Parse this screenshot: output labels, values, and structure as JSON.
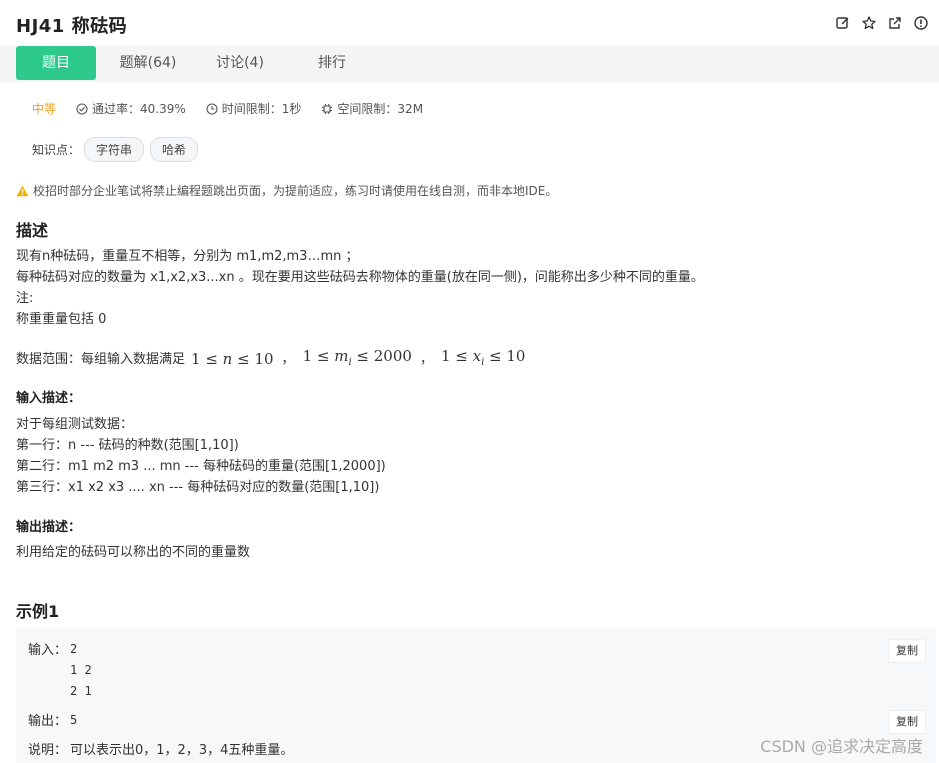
{
  "header": {
    "title": "HJ41  称砝码"
  },
  "tabs": [
    {
      "label": "题目"
    },
    {
      "label": "题解(64)"
    },
    {
      "label": "讨论(4)"
    },
    {
      "label": "排行"
    }
  ],
  "meta": {
    "difficulty": "中等",
    "pass_rate": "通过率：40.39%",
    "time_limit": "时间限制：1秒",
    "memory_limit": "空间限制：32M"
  },
  "knowledge": {
    "label": "知识点：",
    "tags": [
      "字符串",
      "哈希"
    ]
  },
  "notice": "校招时部分企业笔试将禁止编程题跳出页面，为提前适应，练习时请使用在线自测，而非本地IDE。",
  "description": {
    "heading": "描述",
    "lines": [
      "现有n种砝码，重量互不相等，分别为 m1,m2,m3…mn ；",
      "每种砝码对应的数量为 x1,x2,x3...xn 。现在要用这些砝码去称物体的重量(放在同一侧)，问能称出多少种不同的重量。",
      "注:",
      "称重重量包括 0"
    ],
    "range_label": "数据范围：每组输入数据满足",
    "range_sep": "，"
  },
  "input_desc": {
    "heading": "输入描述：",
    "lines": [
      "对于每组测试数据：",
      "第一行：n --- 砝码的种数(范围[1,10])",
      "第二行：m1 m2 m3 ... mn --- 每种砝码的重量(范围[1,2000])",
      "第三行：x1 x2 x3 .... xn --- 每种砝码对应的数量(范围[1,10])"
    ]
  },
  "output_desc": {
    "heading": "输出描述：",
    "text": "利用给定的砝码可以称出的不同的重量数"
  },
  "example": {
    "heading": "示例1",
    "input_label": "输入：",
    "input": "2\n1 2\n2 1",
    "output_label": "输出：",
    "output": "5",
    "explain_label": "说明：",
    "explain": "可以表示出0，1，2，3，4五种重量。",
    "copy_label": "复制"
  },
  "watermark": "CSDN @追求决定高度",
  "colors": {
    "accent": "#2ec98d",
    "difficulty": "#f0a020",
    "warning": "#f0b400"
  }
}
